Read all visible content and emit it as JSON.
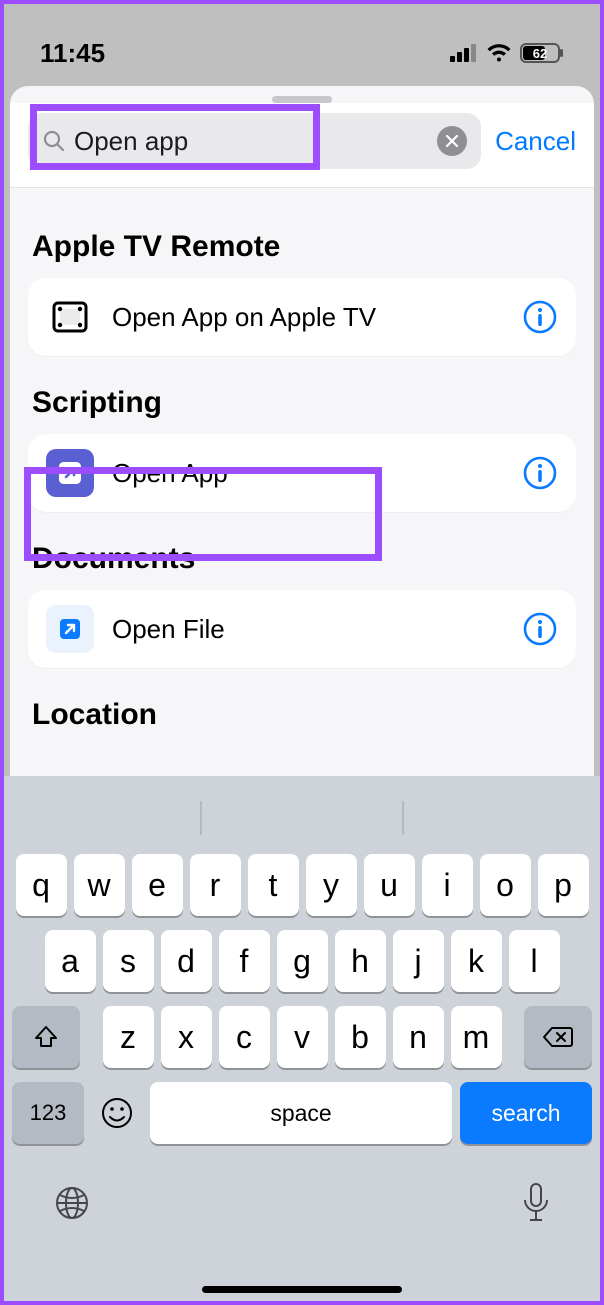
{
  "status": {
    "time": "11:45",
    "battery": "62"
  },
  "search": {
    "value": "Open app",
    "cancel_label": "Cancel"
  },
  "sections": [
    {
      "title": "Apple TV Remote",
      "items": [
        {
          "label": "Open App on Apple TV",
          "icon": "frame-icon"
        }
      ]
    },
    {
      "title": "Scripting",
      "items": [
        {
          "label": "Open App",
          "icon": "shortcut-arrow-icon"
        }
      ]
    },
    {
      "title": "Documents",
      "items": [
        {
          "label": "Open File",
          "icon": "file-arrow-icon"
        }
      ]
    },
    {
      "title": "Location",
      "items": []
    }
  ],
  "keyboard": {
    "rows": [
      [
        "q",
        "w",
        "e",
        "r",
        "t",
        "y",
        "u",
        "i",
        "o",
        "p"
      ],
      [
        "a",
        "s",
        "d",
        "f",
        "g",
        "h",
        "j",
        "k",
        "l"
      ],
      [
        "z",
        "x",
        "c",
        "v",
        "b",
        "n",
        "m"
      ]
    ],
    "num_label": "123",
    "space_label": "space",
    "search_label": "search"
  }
}
